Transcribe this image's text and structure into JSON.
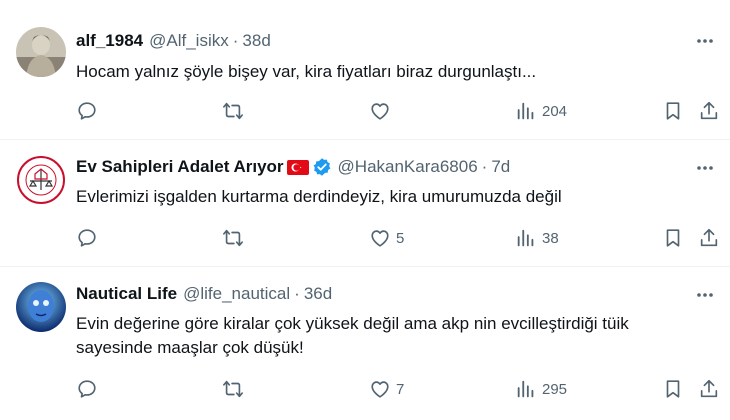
{
  "tweets": [
    {
      "name": "alf_1984",
      "handle": "@Alf_isikx",
      "dot": "·",
      "time": "38d",
      "text": "Hocam yalnız şöyle bişey var, kira fiyatları biraz durgunlaştı...",
      "replies": "",
      "retweets": "",
      "likes": "",
      "views": "204"
    },
    {
      "name": "Ev Sahipleri Adalet Arıyor",
      "handle": "@HakanKara6806",
      "dot": "·",
      "time": "7d",
      "text": "Evlerimizi işgalden kurtarma derdindeyiz, kira umurumuzda değil",
      "replies": "",
      "retweets": "",
      "likes": "5",
      "views": "38",
      "avatar_text": "EV SAHİPLERİ ADALET ARIYOR"
    },
    {
      "name": "Nautical Life",
      "handle": "@life_nautical",
      "dot": "·",
      "time": "36d",
      "text": "Evin değerine göre kiralar çok yüksek değil ama akp nin evcilleştirdiği tüik sayesinde maaşlar çok düşük!",
      "replies": "",
      "retweets": "",
      "likes": "7",
      "views": "295"
    }
  ],
  "icons": {
    "reply": "reply-icon",
    "retweet": "retweet-icon",
    "like": "heart-icon",
    "views": "views-icon",
    "bookmark": "bookmark-icon",
    "share": "share-icon",
    "more": "more-icon",
    "verified": "verified-badge-icon",
    "flag": "turkey-flag-icon"
  },
  "colors": {
    "text": "#0f1419",
    "secondary": "#536471",
    "verified": "#1d9bf0",
    "flag_red": "#e30a17",
    "divider": "#eff3f4"
  }
}
